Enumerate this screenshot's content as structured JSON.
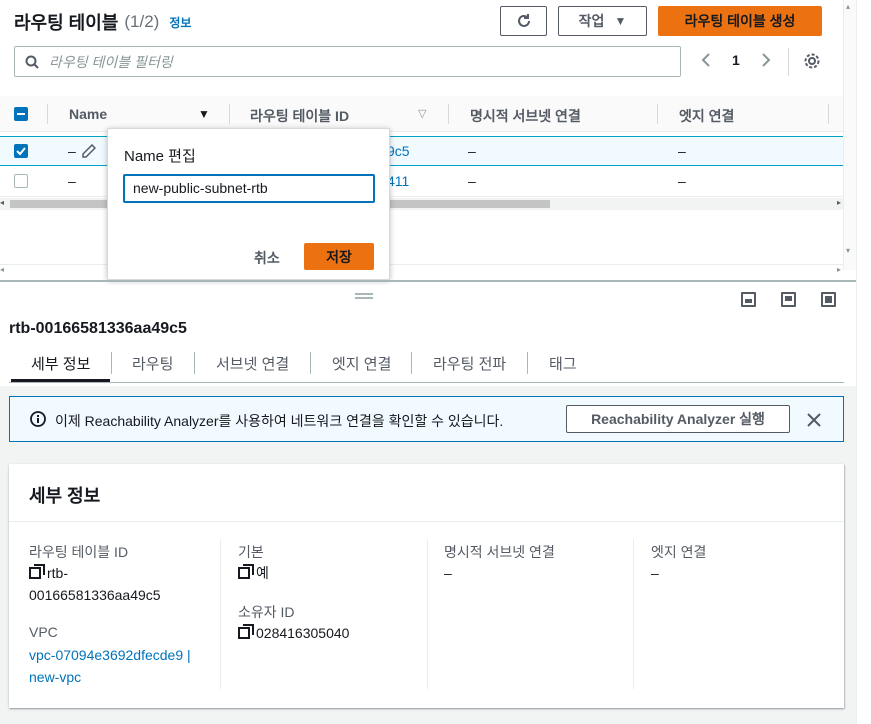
{
  "header": {
    "title": "라우팅 테이블",
    "count": "(1/2)",
    "info": "정보",
    "refresh_icon": "refresh-icon",
    "actions_label": "작업",
    "create_label": "라우팅 테이블 생성"
  },
  "filter": {
    "placeholder": "라우팅 테이블 필터링"
  },
  "pagination": {
    "page": "1"
  },
  "table": {
    "columns": [
      "Name",
      "라우팅 테이블 ID",
      "명시적 서브넷 연결",
      "엣지 연결"
    ],
    "rows": [
      {
        "name": "–",
        "id_fragment": "9c5",
        "subnet": "–",
        "edge": "–",
        "selected": true
      },
      {
        "name": "–",
        "id_fragment": "411",
        "subnet": "–",
        "edge": "–",
        "selected": false
      }
    ]
  },
  "popover": {
    "title": "Name 편집",
    "value": "new-public-subnet-rtb",
    "cancel": "취소",
    "save": "저장"
  },
  "detail": {
    "rtb_id": "rtb-00166581336aa49c5",
    "tabs": [
      "세부 정보",
      "라우팅",
      "서브넷 연결",
      "엣지 연결",
      "라우팅 전파",
      "태그"
    ],
    "alert_text": "이제 Reachability Analyzer를 사용하여 네트워크 연결을 확인할 수 있습니다.",
    "alert_button": "Reachability Analyzer 실행",
    "section_title": "세부 정보",
    "fields": {
      "rt_id_label": "라우팅 테이블 ID",
      "rt_id_value_1": "rtb-",
      "rt_id_value_2": "00166581336aa49c5",
      "vpc_label": "VPC",
      "vpc_value_1": "vpc-07094e3692dfecde9 |",
      "vpc_value_2": "new-vpc",
      "main_label": "기본",
      "main_value": "예",
      "owner_label": "소유자 ID",
      "owner_value": "028416305040",
      "explicit_label": "명시적 서브넷 연결",
      "explicit_value": "–",
      "edge_label": "엣지 연결",
      "edge_value": "–"
    }
  },
  "colors": {
    "accent": "#0073bb",
    "primary_button": "#ec7211",
    "selected_row": "#f1faff"
  }
}
